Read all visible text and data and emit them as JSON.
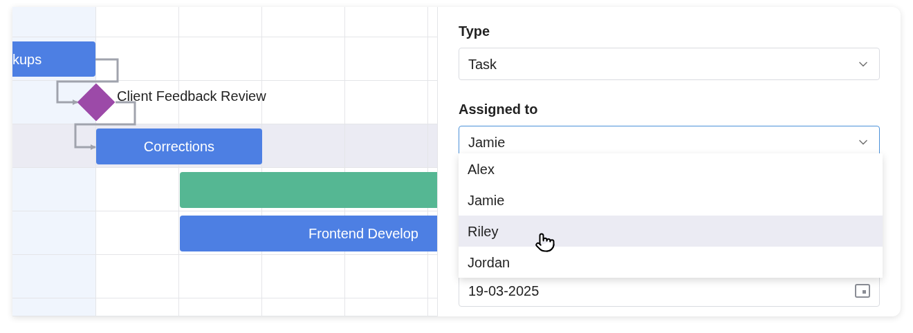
{
  "gantt": {
    "rows": [
      {
        "selected": false
      },
      {
        "selected": false
      },
      {
        "selected": false
      },
      {
        "selected": true
      },
      {
        "selected": false
      },
      {
        "selected": false
      },
      {
        "selected": false
      },
      {
        "selected": false
      }
    ],
    "tasks": [
      {
        "kind": "bar",
        "label": "kups",
        "color": "#4d7fe3"
      },
      {
        "kind": "milestone",
        "label": "Client Feedback Review",
        "color": "#9c4aa8"
      },
      {
        "kind": "bar",
        "label": "Corrections",
        "color": "#4d7fe3"
      },
      {
        "kind": "bar",
        "color": "#55b793"
      },
      {
        "kind": "bar",
        "label": "Frontend Develop",
        "color": "#4d7fe3"
      }
    ]
  },
  "form": {
    "type": {
      "label": "Type",
      "value": "Task"
    },
    "assigned_to": {
      "label": "Assigned to",
      "value": "Jamie",
      "focused": true,
      "options": [
        {
          "label": "Alex",
          "hovered": false
        },
        {
          "label": "Jamie",
          "hovered": false
        },
        {
          "label": "Riley",
          "hovered": true
        },
        {
          "label": "Jordan",
          "hovered": false
        }
      ]
    },
    "date": {
      "value": "19-03-2025"
    }
  }
}
